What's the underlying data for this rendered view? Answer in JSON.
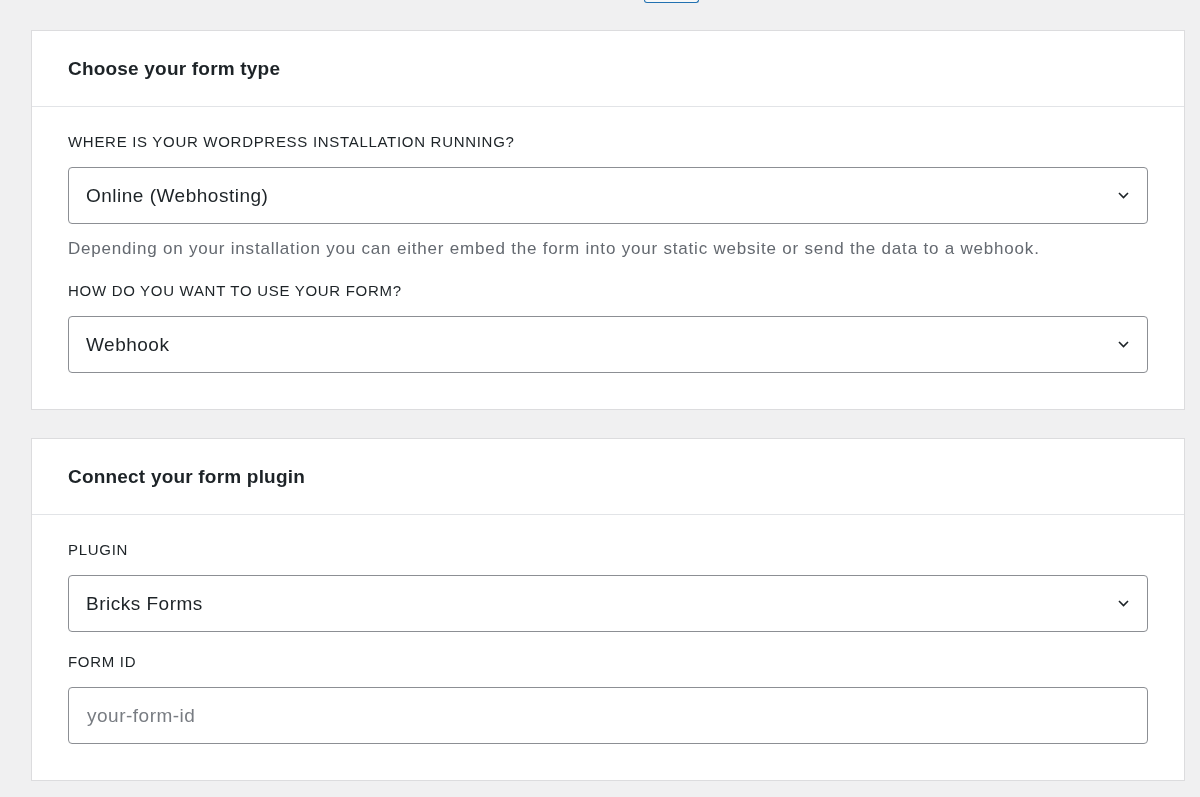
{
  "sections": [
    {
      "title": "Choose your form type",
      "fields": [
        {
          "kind": "select",
          "label": "WHERE IS YOUR WORDPRESS INSTALLATION RUNNING?",
          "value": "Online (Webhosting)",
          "help": "Depending on your installation you can either embed the form into your static website or send the data to a webhook."
        },
        {
          "kind": "select",
          "label": "HOW DO YOU WANT TO USE YOUR FORM?",
          "value": "Webhook"
        }
      ]
    },
    {
      "title": "Connect your form plugin",
      "fields": [
        {
          "kind": "select",
          "label": "PLUGIN",
          "value": "Bricks Forms"
        },
        {
          "kind": "text",
          "label": "FORM ID",
          "placeholder": "your-form-id"
        }
      ]
    }
  ]
}
